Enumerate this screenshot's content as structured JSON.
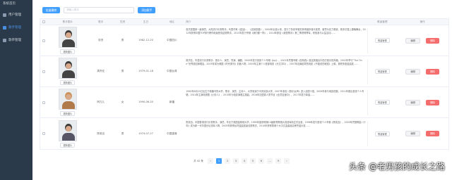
{
  "sidebar": {
    "top_label": "系统首页",
    "items": [
      {
        "label": "用户管理",
        "active": false
      },
      {
        "label": "歌手管理",
        "active": true
      },
      {
        "label": "歌单管理",
        "active": false
      }
    ]
  },
  "toolbar": {
    "batch_delete_label": "批量删除",
    "search_placeholder": "请输入歌手",
    "add_singer_label": "添加歌手"
  },
  "table": {
    "headers": [
      "歌手图片",
      "歌手",
      "性别",
      "生日",
      "地区",
      "简介",
      "歌曲管理",
      "操作"
    ],
    "rows": [
      {
        "photo_btn": "更新图片",
        "name": "张杰",
        "sex": "男",
        "birth": "1982-12-20",
        "area": "中国四川",
        "bio": "张杰是国家一级演员，大陆流行乐男歌手，代表作有《逆战》、《这就是爱》，2004年出道以来，发行了多张专辑并获得诸多音乐奖项，被誉为实力唱将，曾多次登上春晚舞台，2012年获得中国TOP排行榜内地最受欢迎男歌手，2013年发行专辑《我们都一样》，2014年参加《我是歌手》第二季获得季军，积极参与公益活动……",
        "song_btn": "歌曲管理",
        "edit": "编辑",
        "delete": "删除"
      },
      {
        "photo_btn": "更新图片",
        "name": "周杰伦",
        "sex": "男",
        "birth": "1979-01-18",
        "area": "中国台湾",
        "bio": "周杰伦，华语流行乐男歌手、音乐人、演员、导演、编剧，2000年发行首张个人专辑《Jay》，2001年凭借专辑《范特西》奠定其融合中西方音乐的风格，2002年举行“The One”世界巡回演唱会，2003年成为美国《时代周刊》封面人物，2005年主演个人首部电影《头文字D》，2007年自编自导的电影《不能说的秘密》上映，曾获多座金曲奖……",
        "song_btn": "歌曲管理",
        "edit": "编辑",
        "delete": "删除"
      },
      {
        "photo_btn": "更新图片",
        "name": "阿冗儿",
        "sex": "女",
        "birth": "1990-06-20",
        "area": "新疆",
        "bio": "1990年6月20日出生于新疆乌鲁木齐，歌手、演员、主持人，大学就读于中央民族大学，2007年参加《快乐女声》进入全国十强，2009年参与电影拍摄，2011年推出首张个人专辑，2014年主演电视剧《小情人》，2015年为电影演唱主题曲，2016年加盟真人秀节目《全员加速中》，2017年发行单曲……",
        "song_btn": "歌曲管理",
        "edit": "编辑",
        "delete": "删除"
      },
      {
        "photo_btn": "更新图片",
        "name": "陈奕迅",
        "sex": "男",
        "birth": "1974-07-27",
        "area": "中国香港",
        "bio": "陈奕迅，中国香港流行乐男歌手、演员，毕业于英国金斯顿大学，1995年因获得第14届新秀歌唱大赛冠军而正式出道，1996年发行首张个人专辑《陈奕迅》，2003年凭借歌曲《十年》成为新一代华语乐坛领军人物，2005年获得台湾金曲奖最佳男歌手，2010年获得香港十大中文金曲最高荣誉金针奖……",
        "song_btn": "歌曲管理",
        "edit": "编辑",
        "delete": "删除"
      }
    ]
  },
  "pager": {
    "total": "共 42 条",
    "prev": "‹",
    "pages": [
      "1",
      "2",
      "3",
      "4",
      "5",
      "6",
      "…",
      "9"
    ],
    "active": "1",
    "next": "›"
  },
  "watermark": "头条 @老男孩的成长之路",
  "colors": {
    "sidebar": "#2b3a4a",
    "primary": "#409eff",
    "danger": "#f56c6c"
  }
}
